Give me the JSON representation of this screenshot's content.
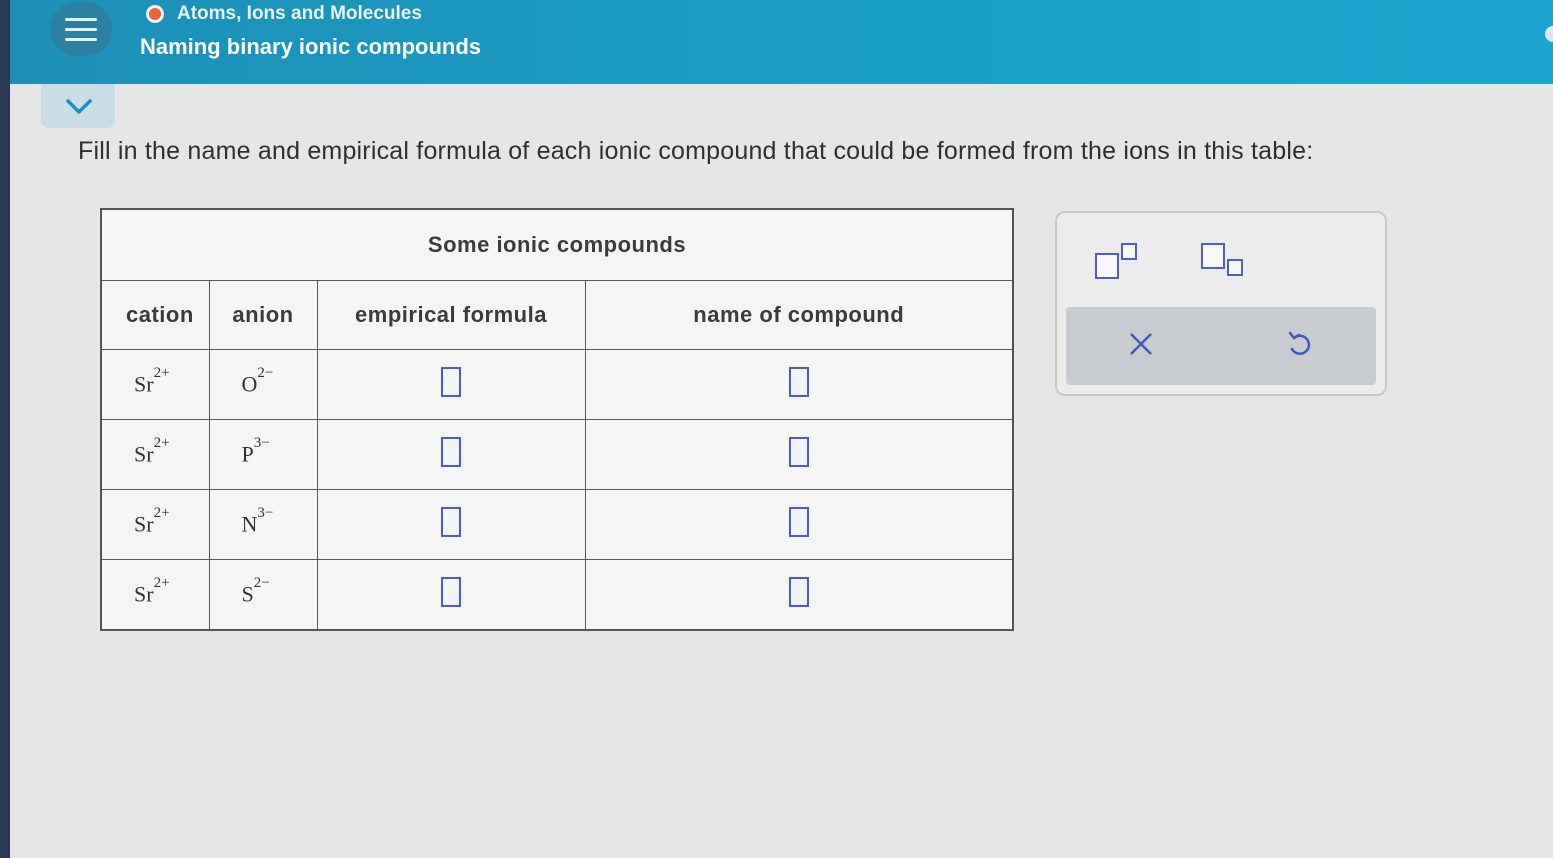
{
  "header": {
    "topic": "Atoms, Ions and Molecules",
    "title": "Naming binary ionic compounds",
    "topic_dot_color": "#e8643a",
    "accent_color": "#1a9cc4"
  },
  "question": {
    "prompt": "Fill in the name and empirical formula of each ionic compound that could be formed from the ions in this table:"
  },
  "table": {
    "caption": "Some ionic compounds",
    "columns": [
      "cation",
      "anion",
      "empirical formula",
      "name of compound"
    ],
    "rows": [
      {
        "cation": "Sr",
        "cation_charge": "2+",
        "anion": "O",
        "anion_charge": "2−",
        "formula": "",
        "name": ""
      },
      {
        "cation": "Sr",
        "cation_charge": "2+",
        "anion": "P",
        "anion_charge": "3−",
        "formula": "",
        "name": ""
      },
      {
        "cation": "Sr",
        "cation_charge": "2+",
        "anion": "N",
        "anion_charge": "3−",
        "formula": "",
        "name": ""
      },
      {
        "cation": "Sr",
        "cation_charge": "2+",
        "anion": "S",
        "anion_charge": "2−",
        "formula": "",
        "name": ""
      }
    ]
  },
  "tools": {
    "icons": [
      "superscript-template-icon",
      "subscript-template-icon",
      "clear-icon",
      "undo-icon"
    ]
  }
}
